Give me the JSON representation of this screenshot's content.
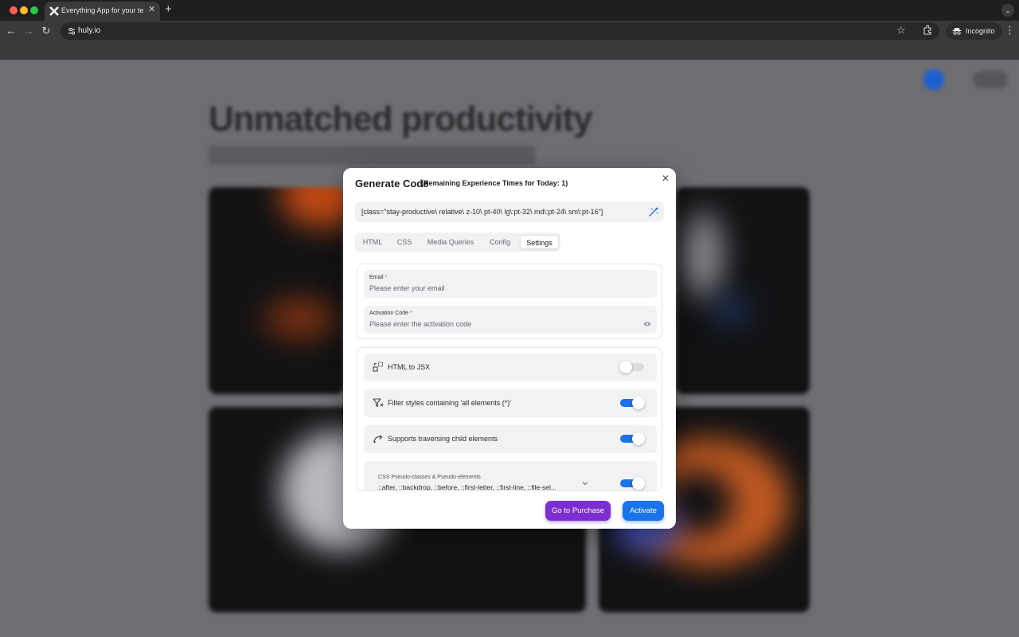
{
  "browser": {
    "tab_title": "Everything App for your teams",
    "url": "huly.io",
    "profile_label": "Incognito"
  },
  "page_background": {
    "headline": "Unmatched productivity"
  },
  "modal": {
    "title": "Generate Code",
    "note": "(Remaining Experience Times for Today: 1)",
    "selector": "[class=\"stay-productive\\ relative\\ z-10\\ pt-40\\ lg\\:pt-32\\ md\\:pt-24\\ sm\\:pt-16\"]",
    "tabs": [
      {
        "label": "HTML",
        "active": false
      },
      {
        "label": "CSS",
        "active": false
      },
      {
        "label": "Media Queries",
        "active": false
      },
      {
        "label": "Config",
        "active": false
      },
      {
        "label": "Settings",
        "active": true
      }
    ],
    "email": {
      "label": "Email",
      "required_mark": "*",
      "placeholder": "Please enter your email"
    },
    "activation_code": {
      "label": "Activation Code",
      "required_mark": "*",
      "placeholder": "Please enter the activation code"
    },
    "options": [
      {
        "label": "HTML to JSX",
        "icon": "jsx-convert-icon",
        "enabled": false
      },
      {
        "label": "Filter styles containing 'all elements (*)'",
        "icon": "filter-icon",
        "enabled": true
      },
      {
        "label": "Supports traversing child elements",
        "icon": "traverse-arrow-icon",
        "enabled": true
      }
    ],
    "pseudo": {
      "title": "CSS Pseudo-classes & Pseudo-elements",
      "values": "::after, ::backdrop, ::before, ::first-letter, ::first-line, ::file-sel...",
      "enabled": true
    },
    "buttons": {
      "purchase": "Go to Purchase",
      "activate": "Activate"
    }
  },
  "colors": {
    "accent_blue": "#1a73e8",
    "purchase_purple": "#7b2fd0",
    "required_red": "#e5484d"
  }
}
